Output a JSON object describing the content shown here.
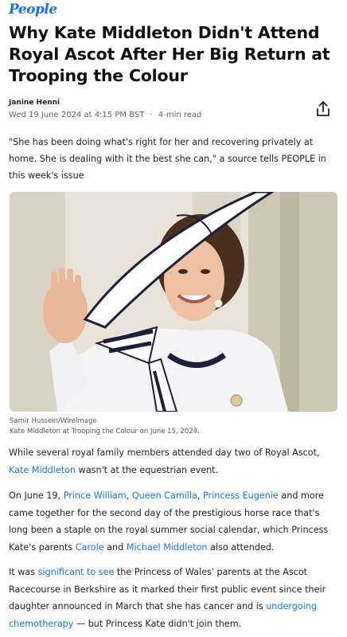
{
  "brand": {
    "logo_text": "People",
    "accent": "#1a73e8"
  },
  "article": {
    "headline": "Why Kate Middleton Didn't Attend Royal Ascot After Her Big Return at Trooping the Colour",
    "author": "Janine Henni",
    "date": "Wed 19 June 2024 at 4:15 PM BST",
    "separator": "·",
    "read_time": "4-min read",
    "share_icon": "share-icon",
    "pull_quote": "\"She has been doing what's right for her and recovering privately at home. She is dealing with it the best she can,\" a source tells PEOPLE in this week's issue",
    "image": {
      "credit": "Samir Hussein/WireImage",
      "caption": "Kate Middleton at Trooping the Colour on June 15, 2024."
    },
    "p1": {
      "t1": "While several royal family members attended day two of Royal Ascot, ",
      "link1": "Kate Middleton",
      "t2": " wasn't at the equestrian event."
    },
    "p2": {
      "t1": "On June 19, ",
      "link1": "Prince William",
      "t2": ", ",
      "link2": "Queen Camilla",
      "t3": ", ",
      "link3": "Princess Eugenie",
      "t4": " and more came together for the second day of the prestigious horse race that's long been a staple on the royal summer social calendar, which Princess Kate's parents ",
      "link4": "Carole",
      "t5": " and ",
      "link5": "Michael Middleton",
      "t6": " also attended."
    },
    "p3": {
      "t1": "It was ",
      "link1": "significant to see",
      "t2": " the Princess of Wales' parents at the Ascot Racecourse in Berkshire as it marked their first public event since their daughter announced in March that she has cancer and is ",
      "link2": "undergoing chemotherapy",
      "t3": " — but Princess Kate didn't join them."
    }
  }
}
